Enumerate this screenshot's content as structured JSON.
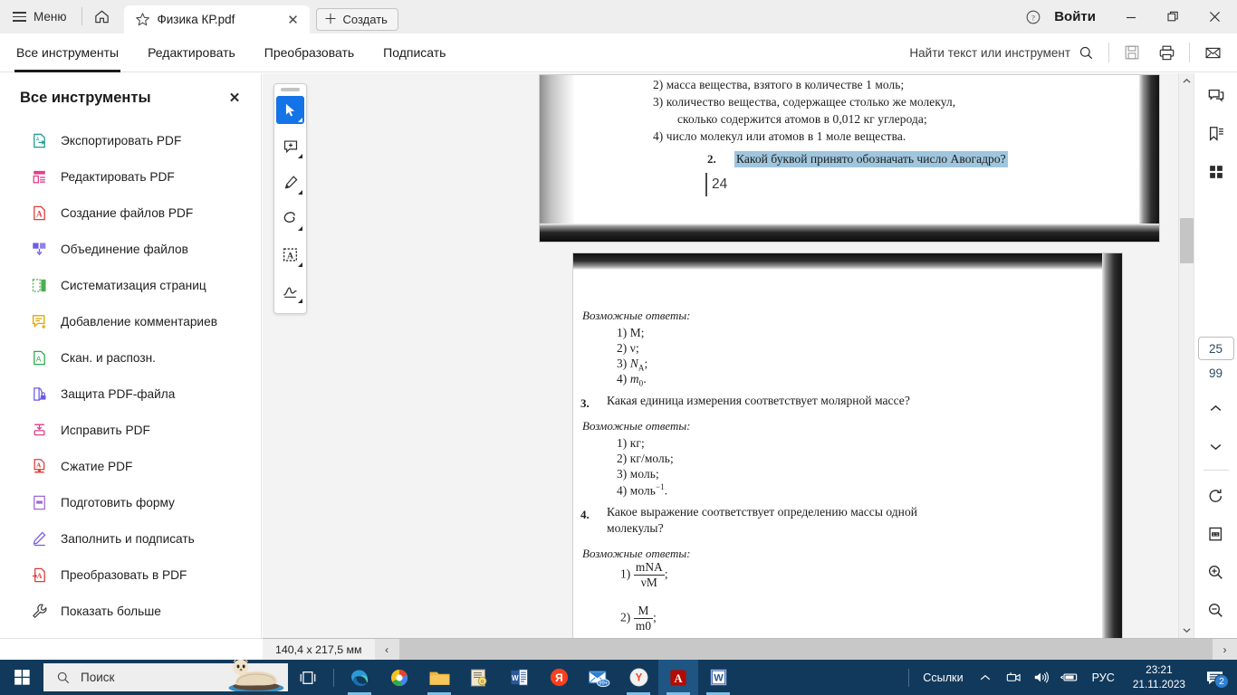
{
  "window": {
    "menu_label": "Меню",
    "home_icon": "home-icon",
    "signin_label": "Войти",
    "help_icon": "help-circle-icon",
    "minimize_icon": "minimize-icon",
    "restore_icon": "restore-icon",
    "close_icon": "close-icon",
    "tab": {
      "title": "Физика КР.pdf",
      "star_icon": "star-icon",
      "close_icon": "close-icon"
    },
    "new_tab_label": "Создать"
  },
  "toolbar": {
    "tabs": [
      {
        "label": "Все инструменты",
        "active": true
      },
      {
        "label": "Редактировать",
        "active": false
      },
      {
        "label": "Преобразовать",
        "active": false
      },
      {
        "label": "Подписать",
        "active": false
      }
    ],
    "search_placeholder": "Найти текст или инструмент",
    "search_icon": "search-icon",
    "save_icon": "save-disk-icon",
    "print_icon": "printer-icon",
    "mail_icon": "envelope-icon"
  },
  "left_panel": {
    "title": "Все инструменты",
    "close_icon": "close-icon",
    "items": [
      {
        "label": "Экспортировать PDF",
        "icon": "export-pdf-icon",
        "color": "#1a9c8f"
      },
      {
        "label": "Редактировать PDF",
        "icon": "edit-pdf-icon",
        "color": "#e0408a"
      },
      {
        "label": "Создание файлов PDF",
        "icon": "create-pdf-icon",
        "color": "#e03b3b"
      },
      {
        "label": "Объединение файлов",
        "icon": "combine-files-icon",
        "color": "#6b5ce7"
      },
      {
        "label": "Систематизация страниц",
        "icon": "organize-pages-icon",
        "color": "#4caf50"
      },
      {
        "label": "Добавление комментариев",
        "icon": "comment-icon",
        "color": "#e0a800"
      },
      {
        "label": "Скан. и распозн.",
        "icon": "scan-ocr-icon",
        "color": "#2fa84f"
      },
      {
        "label": "Защита PDF-файла",
        "icon": "protect-pdf-icon",
        "color": "#6b5ce7"
      },
      {
        "label": "Исправить PDF",
        "icon": "fix-pdf-icon",
        "color": "#e0408a"
      },
      {
        "label": "Сжатие PDF",
        "icon": "compress-pdf-icon",
        "color": "#e03b3b"
      },
      {
        "label": "Подготовить форму",
        "icon": "prepare-form-icon",
        "color": "#9b6bd6"
      },
      {
        "label": "Заполнить и подписать",
        "icon": "fill-sign-icon",
        "color": "#7b5ce0"
      },
      {
        "label": "Преобразовать в PDF",
        "icon": "convert-to-pdf-icon",
        "color": "#e03b3b"
      },
      {
        "label": "Показать больше",
        "icon": "wrench-icon",
        "color": "#3a3a3a"
      }
    ]
  },
  "vertical_toolbar": {
    "grip_icon": "drag-grip-icon",
    "buttons": [
      {
        "icon": "select-cursor-icon",
        "active": true
      },
      {
        "icon": "add-comment-icon",
        "active": false
      },
      {
        "icon": "highlighter-pen-icon",
        "active": false
      },
      {
        "icon": "draw-freehand-icon",
        "active": false
      },
      {
        "icon": "edit-text-box-icon",
        "active": false
      },
      {
        "icon": "signature-icon",
        "active": false
      }
    ]
  },
  "right_rail": {
    "buttons": [
      {
        "icon": "comments-panel-icon"
      },
      {
        "icon": "bookmarks-panel-icon"
      },
      {
        "icon": "thumbnails-grid-icon"
      }
    ],
    "current_page": "25",
    "total_pages": "99",
    "prev_page_icon": "chevron-up-icon",
    "next_page_icon": "chevron-down-icon",
    "rotate_icon": "rotate-clockwise-icon",
    "actual_size_icon": "page-fit-1to1-icon",
    "zoom_in_icon": "zoom-in-icon",
    "zoom_out_icon": "zoom-out-icon"
  },
  "document_scroll": {
    "up_icon": "scroll-up-arrow",
    "down_icon": "scroll-down-arrow"
  },
  "status_bar": {
    "page_dimensions": "140,4 x 217,5 мм",
    "left_arrow": "‹",
    "right_arrow": "›"
  },
  "document": {
    "page_24": {
      "page_number": "24",
      "lines": [
        "2) масса вещества, взятого в количестве 1 моль;",
        "3) количество вещества, содержащее столько же молекул,",
        "сколько содержится атомов в 0,012 кг углерода;",
        "4) число молекул или атомов в 1 моле вещества."
      ],
      "question": {
        "number": "2.",
        "text": "Какой буквой принято обозначать число Авогадро?",
        "highlighted": true
      },
      "handwritten_page_marker": "24",
      "highlight_color": "#9fc6dd"
    },
    "page_25": {
      "answers_label_1": "Возможные ответы:",
      "answers_1": [
        "1) M;",
        "2) ν;",
        "3) N",
        "4) m"
      ],
      "answers_1_full": [
        "1) M;",
        "2) ν;",
        "3) NA;",
        "4) m0."
      ],
      "question_3": {
        "number": "3.",
        "text": "Какая единица измерения соответствует молярной массе?"
      },
      "answers_label_2": "Возможные ответы:",
      "answers_2": [
        "1) кг;",
        "2) кг/моль;",
        "3) моль;",
        "4) моль⁻¹."
      ],
      "question_4": {
        "number": "4.",
        "line1": "Какое выражение соответствует определению массы одной",
        "line2": "молекулы?"
      },
      "answers_label_3": "Возможные ответы:",
      "formula_1": {
        "index": "1)",
        "numerator": "mNA",
        "denominator": "νM",
        "suffix": ";"
      },
      "formula_2": {
        "index": "2)",
        "numerator": "M",
        "denominator": "m0",
        "suffix": ";"
      }
    }
  },
  "taskbar": {
    "start_icon": "windows-start-icon",
    "search_placeholder": "Поиск",
    "search_icon": "search-icon",
    "seal_icon": "seal-mascot-icon",
    "task_view_icon": "task-view-icon",
    "apps": [
      {
        "icon": "microsoft-edge-icon",
        "running": true
      },
      {
        "icon": "multicolor-browser-icon",
        "running": false
      },
      {
        "icon": "file-explorer-icon",
        "running": true
      },
      {
        "icon": "sticky-notes-icon",
        "running": false
      },
      {
        "icon": "microsoft-word-icon",
        "running": false
      },
      {
        "icon": "yandex-red-icon",
        "running": false
      },
      {
        "icon": "mail-app-icon",
        "running": false,
        "badge": "99+"
      },
      {
        "icon": "yandex-browser-icon",
        "running": true
      },
      {
        "icon": "adobe-acrobat-icon",
        "running": true,
        "active": true
      },
      {
        "icon": "word-document-icon",
        "running": true
      }
    ],
    "tray_label": "Ссылки",
    "tray_chevron_icon": "chevron-up-icon",
    "tray_icons": [
      "camera-icon",
      "volume-icon",
      "battery-icon"
    ],
    "language": "РУС",
    "time": "23:21",
    "date": "21.11.2023",
    "notification_icon": "notification-icon",
    "notification_count": "2"
  }
}
